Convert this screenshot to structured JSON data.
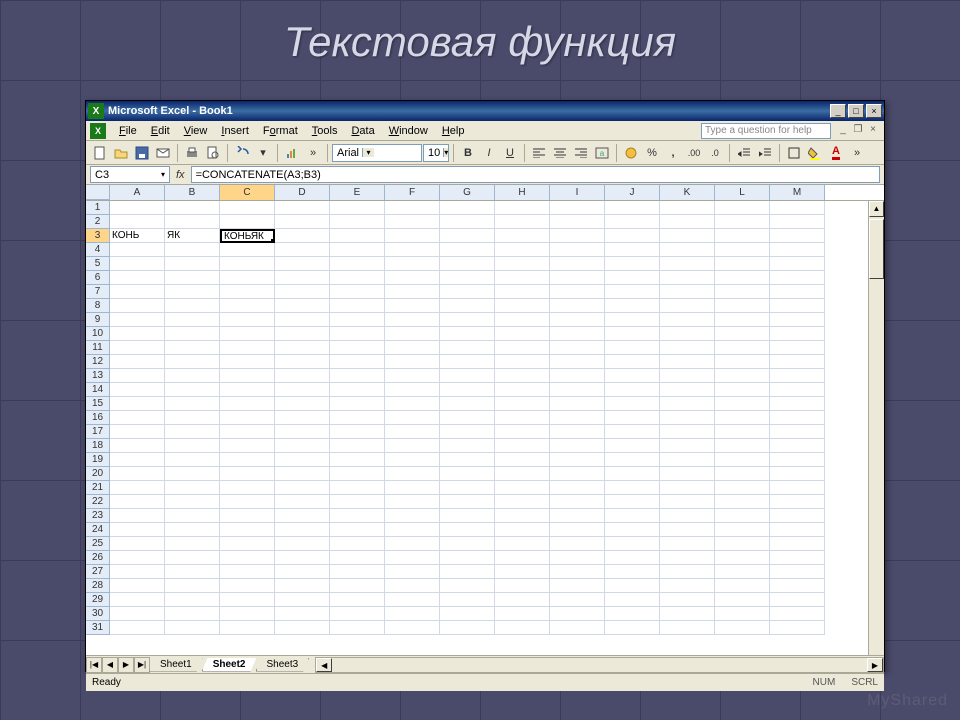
{
  "slide": {
    "title": "Текстовая функция"
  },
  "window": {
    "title": "Microsoft Excel - Book1",
    "min": "_",
    "max": "□",
    "close": "×"
  },
  "menu": {
    "file": "File",
    "edit": "Edit",
    "view": "View",
    "insert": "Insert",
    "format": "Format",
    "tools": "Tools",
    "data": "Data",
    "window": "Window",
    "help": "Help",
    "help_placeholder": "Type a question for help"
  },
  "toolbar": {
    "font_name": "Arial",
    "font_size": "10",
    "bold": "B",
    "italic": "I",
    "underline": "U",
    "currency": "$",
    "percent": "%",
    "comma": ","
  },
  "formula": {
    "name_box": "C3",
    "fx": "fx",
    "value": "=CONCATENATE(A3;B3)"
  },
  "columns": [
    "A",
    "B",
    "C",
    "D",
    "E",
    "F",
    "G",
    "H",
    "I",
    "J",
    "K",
    "L",
    "M"
  ],
  "selected_col": "C",
  "rows_count": 31,
  "selected_row": 3,
  "cells": {
    "A3": "КОНЬ",
    "B3": "ЯК",
    "C3": "КОНЬЯК"
  },
  "active_cell": "C3",
  "tabs": {
    "nav": [
      "|◀",
      "◀",
      "▶",
      "▶|"
    ],
    "sheets": [
      "Sheet1",
      "Sheet2",
      "Sheet3"
    ],
    "active": "Sheet2"
  },
  "status": {
    "ready": "Ready",
    "num": "NUM",
    "scrl": "SCRL"
  },
  "watermark": "MyShared"
}
